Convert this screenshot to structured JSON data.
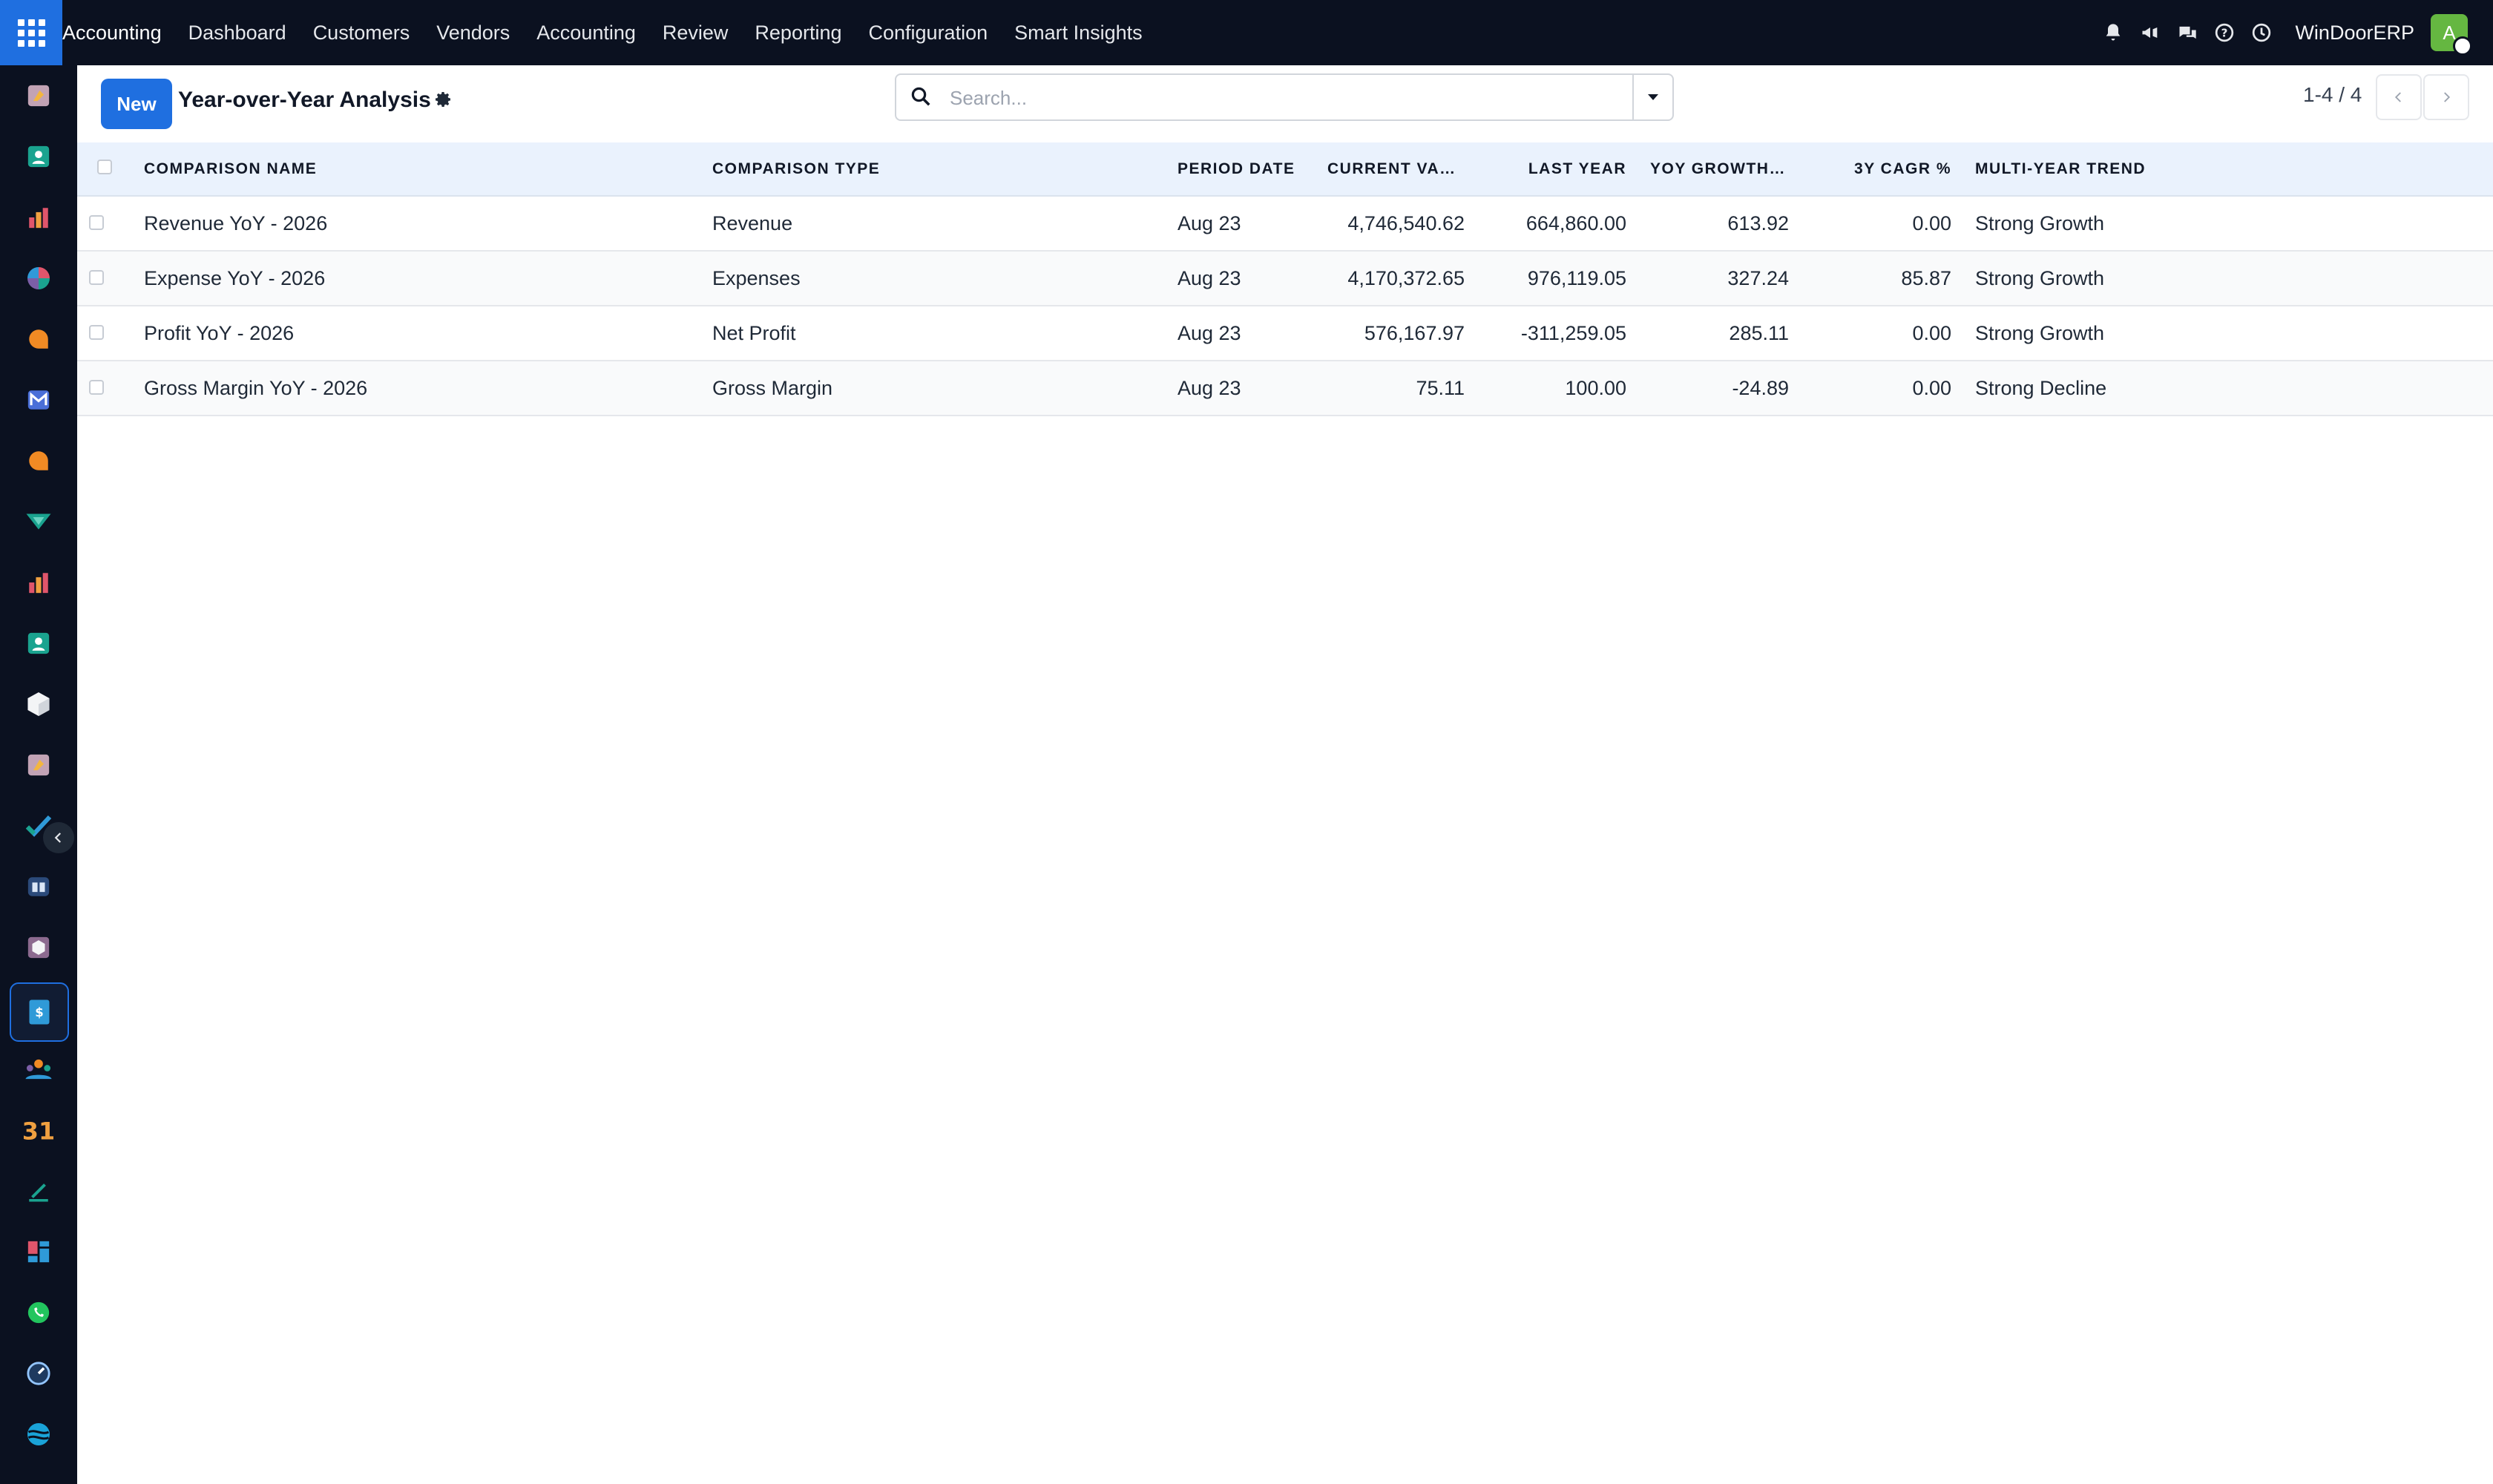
{
  "topbar": {
    "brand": "Accounting",
    "menu": [
      "Dashboard",
      "Customers",
      "Vendors",
      "Accounting",
      "Review",
      "Reporting",
      "Configuration",
      "Smart Insights"
    ],
    "company": "WinDoorERP",
    "avatar_letter": "A"
  },
  "rail": {
    "apps": [
      "discuss-app-icon",
      "contacts-app-icon",
      "reporting-app-icon",
      "dashboards-app-icon",
      "livechat-app-icon",
      "email-marketing-app-icon",
      "chat-app-icon",
      "verified-app-icon",
      "reporting-app-icon-2",
      "employees-app-icon",
      "inventory-app-icon",
      "discuss-app-icon-2",
      "tasks-app-icon",
      "knowledge-app-icon",
      "products-app-icon",
      "invoicing-app-icon",
      "team-app-icon",
      "calendar-app-icon",
      "sign-app-icon",
      "dashboard-blocks-app-icon",
      "whatsapp-app-icon",
      "timer-app-icon",
      "website-app-icon"
    ],
    "active_index": 15
  },
  "control": {
    "new_label": "New",
    "title": "Year-over-Year Analysis",
    "search_placeholder": "Search...",
    "pager": "1-4 / 4"
  },
  "table": {
    "headers": {
      "name": "Comparison Name",
      "type": "Comparison Type",
      "period": "Period Date",
      "current": "Current Val...",
      "last": "Last Year",
      "yoy": "YoY Growth %",
      "cagr": "3Y CAGR %",
      "trend": "Multi-Year Trend"
    },
    "rows": [
      {
        "name": "Revenue YoY - 2026",
        "type": "Revenue",
        "period": "Aug 23",
        "current": "4,746,540.62",
        "last": "664,860.00",
        "yoy": "613.92",
        "cagr": "0.00",
        "trend": "Strong Growth"
      },
      {
        "name": "Expense YoY - 2026",
        "type": "Expenses",
        "period": "Aug 23",
        "current": "4,170,372.65",
        "last": "976,119.05",
        "yoy": "327.24",
        "cagr": "85.87",
        "trend": "Strong Growth"
      },
      {
        "name": "Profit YoY - 2026",
        "type": "Net Profit",
        "period": "Aug 23",
        "current": "576,167.97",
        "last": "-311,259.05",
        "yoy": "285.11",
        "cagr": "0.00",
        "trend": "Strong Growth"
      },
      {
        "name": "Gross Margin YoY - 2026",
        "type": "Gross Margin",
        "period": "Aug 23",
        "current": "75.11",
        "last": "100.00",
        "yoy": "-24.89",
        "cagr": "0.00",
        "trend": "Strong Decline"
      }
    ]
  },
  "colors": {
    "nav_bg": "#0b1120",
    "accent": "#1f6fe0",
    "header_row_bg": "#eaf2fd",
    "avatar_bg": "#65b741"
  }
}
